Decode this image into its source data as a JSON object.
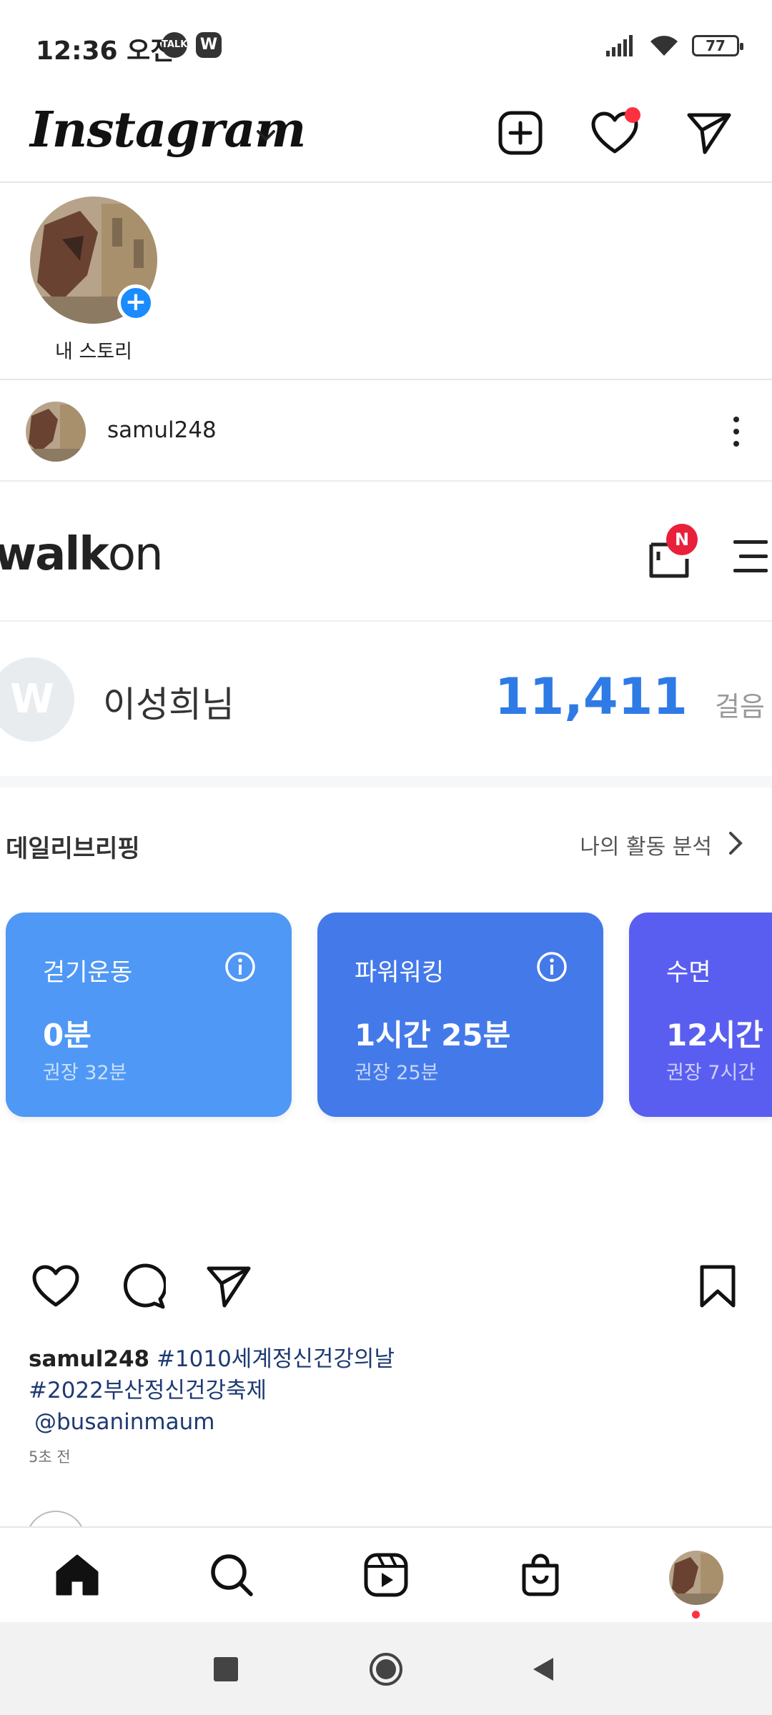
{
  "status_bar": {
    "time": "12:36 오전",
    "talk_icon": "kakaotalk-icon",
    "w_app_label": "W",
    "battery_level": "77"
  },
  "header": {
    "logo": "Instagram",
    "icons": [
      "plus-square-icon",
      "heart-icon",
      "paper-plane-icon"
    ],
    "activity_dot_color": "#ff3040"
  },
  "stories": {
    "my_story_label": "내 스토리"
  },
  "post": {
    "username": "samul248",
    "walkon": {
      "logo_bold": "walk",
      "logo_thin": "on",
      "badge": "N",
      "user_name": "이성희님",
      "steps": "11,411",
      "steps_unit": "걸음",
      "avatar_letter": "W",
      "brief_title": "데일리브리핑",
      "brief_link": "나의 활동 분석",
      "cards": [
        {
          "title": "걷기운동",
          "value": "0분",
          "sub": "권장 32분",
          "color": "#4f98f5"
        },
        {
          "title": "파워워킹",
          "value": "1시간 25분",
          "sub": "권장 25분",
          "color": "#4479ea"
        },
        {
          "title": "수면",
          "value": "12시간",
          "sub": "권장 7시간",
          "color": "#5a5ef0"
        }
      ]
    },
    "caption_user": "samul248",
    "caption_tag1": "#1010세계정신건강의날",
    "caption_tag2": "#2022부산정신건강축제",
    "caption_mention": "@busaninmaum",
    "time_ago": "5초 전"
  },
  "bottom_nav": {
    "items": [
      "home-icon",
      "search-icon",
      "reels-icon",
      "shop-icon",
      "profile-avatar"
    ]
  },
  "colors": {
    "ig_blue": "#1a8cff",
    "walkon_blue": "#2f7be6",
    "badge_red": "#e8203a"
  }
}
